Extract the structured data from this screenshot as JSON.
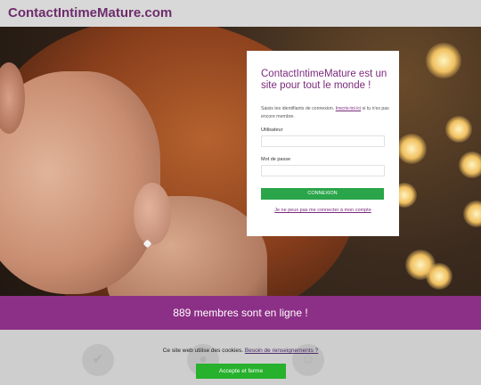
{
  "header": {
    "logo_text": "ContactIntimeMature.com"
  },
  "login": {
    "title": "ContactIntimeMature est un site pour tout le monde !",
    "desc_before": "Saisis tes identifiants de connexion.",
    "desc_link": "Inscris-toi ici",
    "desc_after": "si tu n'es pas encore membre.",
    "username_label": "Utilisateur",
    "password_label": "Mot de passe",
    "submit_label": "CONNEXION",
    "forgot_link": "Je ne peux pas me connecter à mon compte"
  },
  "banner": {
    "text": "889 membres sont en ligne !"
  },
  "cookie": {
    "text": "Ce site web utilise des cookies.",
    "link": "Besoin de renseignements ?",
    "accept_label": "Accepte et ferme"
  },
  "colors": {
    "brand": "#8c2f86",
    "accent_green": "#2aa54a",
    "header_bg": "#d8d8d8"
  },
  "icons": {
    "shield": "shield-check-icon",
    "users": "users-icon"
  }
}
